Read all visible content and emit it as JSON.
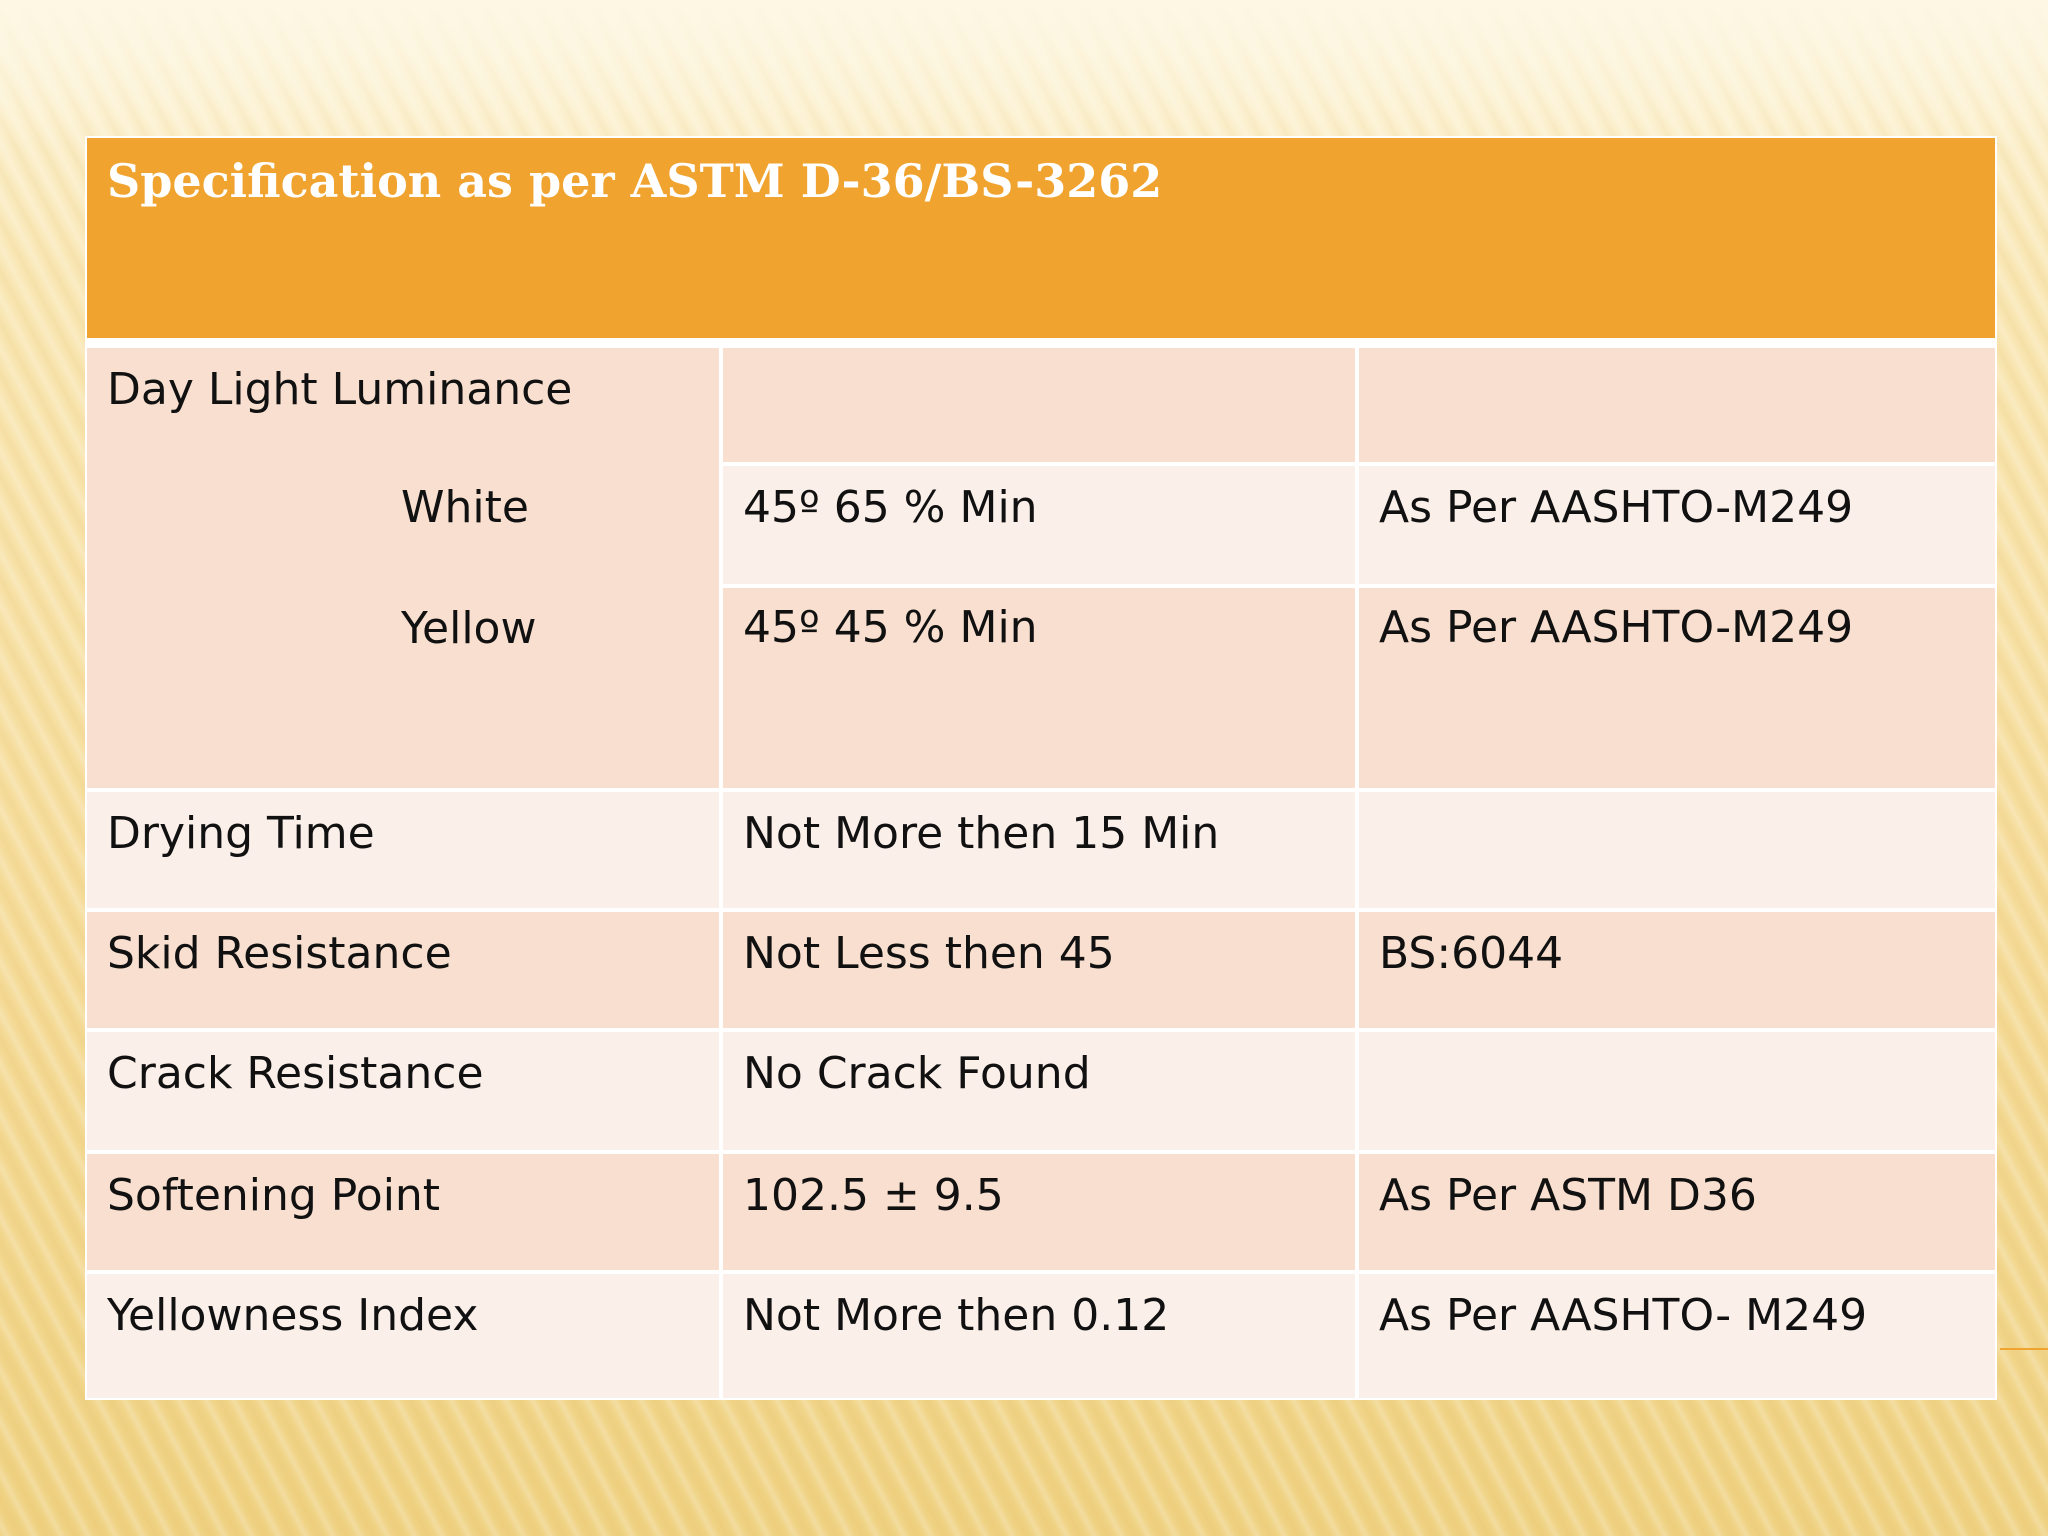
{
  "table": {
    "header": "Specification as per ASTM D-36/BS-3262",
    "luminance": {
      "label": "Day Light Luminance",
      "white_label": "White",
      "white_value": "45º  65 % Min",
      "white_ref": "As Per AASHTO-M249",
      "yellow_label": "Yellow",
      "yellow_value": "45º  45 % Min",
      "yellow_ref": "As Per AASHTO-M249"
    },
    "rows": [
      {
        "property": "Drying Time",
        "value": "Not More then 15 Min",
        "reference": ""
      },
      {
        "property": "Skid Resistance",
        "value": "Not Less then 45",
        "reference": "BS:6044"
      },
      {
        "property": "Crack Resistance",
        "value": "No Crack Found",
        "reference": ""
      },
      {
        "property": "Softening Point",
        "value": "102.5 ± 9.5",
        "reference": "As Per ASTM D36"
      },
      {
        "property": "Yellowness Index",
        "value": "Not More then 0.12",
        "reference": "As Per AASHTO- M249"
      }
    ]
  },
  "colors": {
    "header_bg": "#f0a32f",
    "row_dark": "#f8dfcf",
    "row_light": "#fbefea",
    "background": "#f6dd9d"
  }
}
